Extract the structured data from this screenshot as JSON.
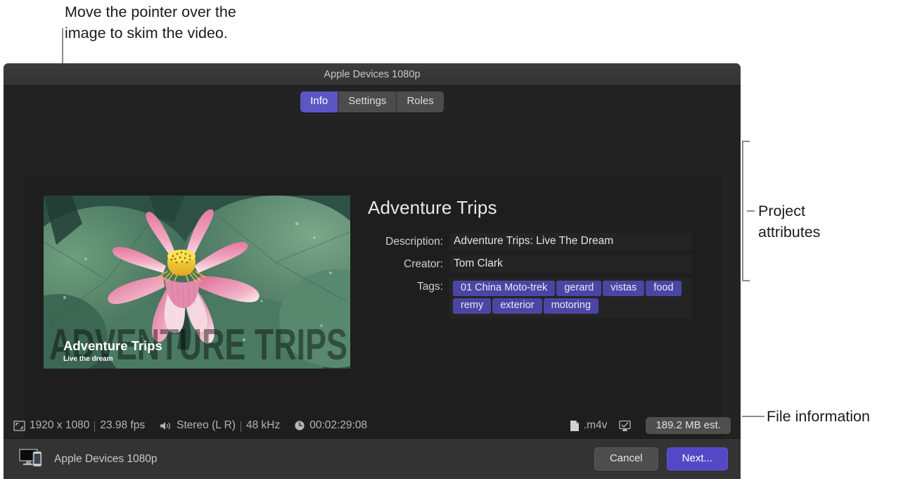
{
  "annotations": {
    "skim_note": "Move the pointer over the\nimage to skim the video.",
    "project_attributes": "Project\nattributes",
    "file_information": "File information"
  },
  "window": {
    "title": "Apple Devices 1080p"
  },
  "tabs": [
    {
      "label": "Info",
      "active": true
    },
    {
      "label": "Settings",
      "active": false
    },
    {
      "label": "Roles",
      "active": false
    }
  ],
  "thumbnail": {
    "overlay_title": "Adventure Trips",
    "overlay_subtitle": "Live the dream",
    "ghost_text": "ADVENTURE TRIPS",
    "description": "lotus-flower-on-lily-pads"
  },
  "project": {
    "title": "Adventure Trips",
    "fields": [
      {
        "label": "Description:",
        "value": "Adventure Trips: Live The Dream"
      },
      {
        "label": "Creator:",
        "value": "Tom Clark"
      }
    ],
    "tags_label": "Tags:",
    "tags": [
      "01 China Moto-trek",
      "gerard",
      "vistas",
      "food",
      "remy",
      "exterior",
      "motoring"
    ]
  },
  "status": {
    "resolution": "1920 x 1080",
    "fps": "23.98 fps",
    "audio_channels": "Stereo (L R)",
    "sample_rate": "48 kHz",
    "duration": "00:02:29:08",
    "file_extension": ".m4v",
    "estimated_size": "189.2 MB est.",
    "icons": {
      "frame": "frame-icon",
      "speaker": "speaker-icon",
      "clock": "clock-icon",
      "document": "document-icon",
      "display": "display-check-icon"
    }
  },
  "bottom": {
    "destination": "Apple Devices 1080p",
    "cancel_label": "Cancel",
    "next_label": "Next..."
  },
  "colors": {
    "accent": "#5c55c4",
    "tag": "#4b46a3",
    "panel": "#1e1e1e",
    "window": "#232323",
    "toolbar": "#333333"
  }
}
